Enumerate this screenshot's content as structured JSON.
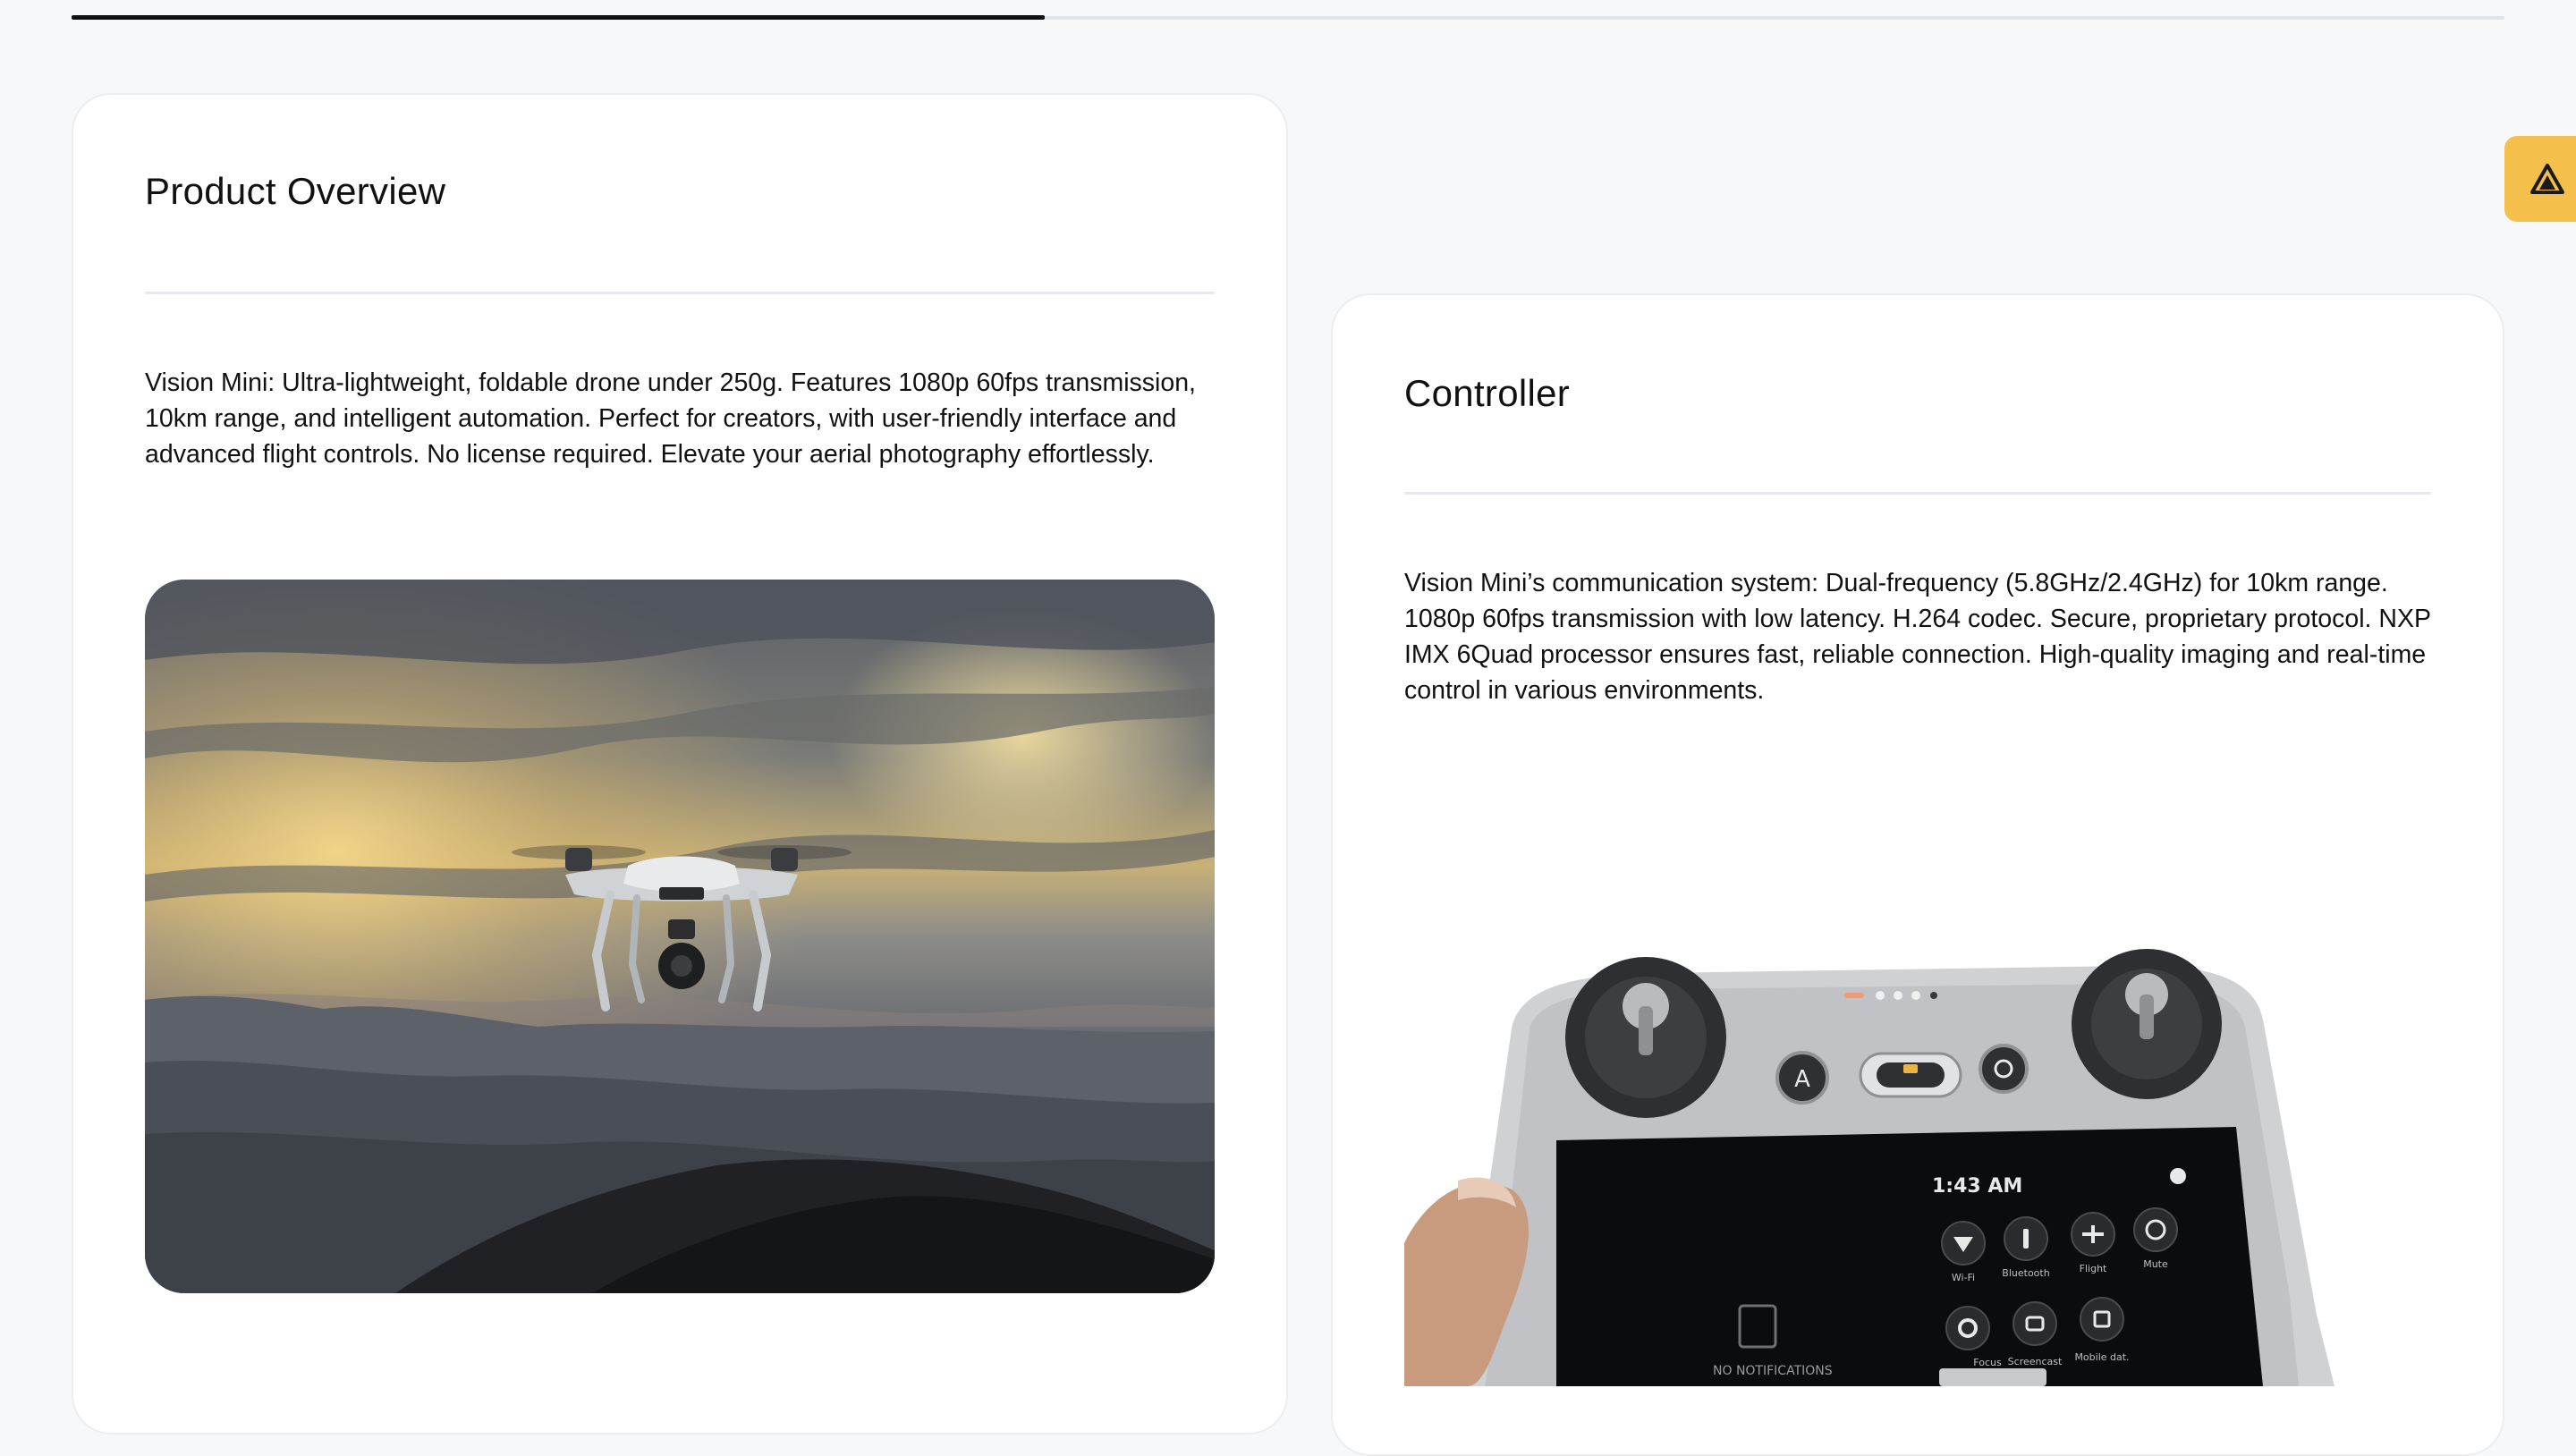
{
  "progress": {
    "fraction": 0.4
  },
  "overview": {
    "title": "Product Overview",
    "description": "Vision Mini: Ultra-lightweight, foldable drone under 250g. Features 1080p 60fps transmission, 10km range, and intelligent automation. Perfect for creators, with user-friendly interface and advanced flight controls. No license required. Elevate your aerial photography effortlessly.",
    "image_alt": "Drone flying over mountains at sunset"
  },
  "controller": {
    "title": "Controller",
    "description": "Vision Mini’s communication system: Dual-frequency (5.8GHz/2.4GHz) for 10km range. 1080p 60fps transmission with low latency. H.264 codec. Secure, proprietary protocol. NXP IMX 6Quad processor ensures fast, reliable connection. High-quality imaging and real-time control in various environments.",
    "image_alt": "Hand holding the Vision Mini remote controller",
    "screen_time": "1:43 AM",
    "screen_labels": [
      "Wi-Fi",
      "Bluetooth",
      "Flight",
      "Mute",
      "Focus",
      "Screencast",
      "Mobile dat."
    ],
    "screen_notice": "NO NOTIFICATIONS"
  },
  "badge": {
    "icon": "brand-logo-icon"
  },
  "colors": {
    "accent": "#f4bf4a",
    "page_bg": "#f7f8f9",
    "card_bg": "#ffffff"
  }
}
